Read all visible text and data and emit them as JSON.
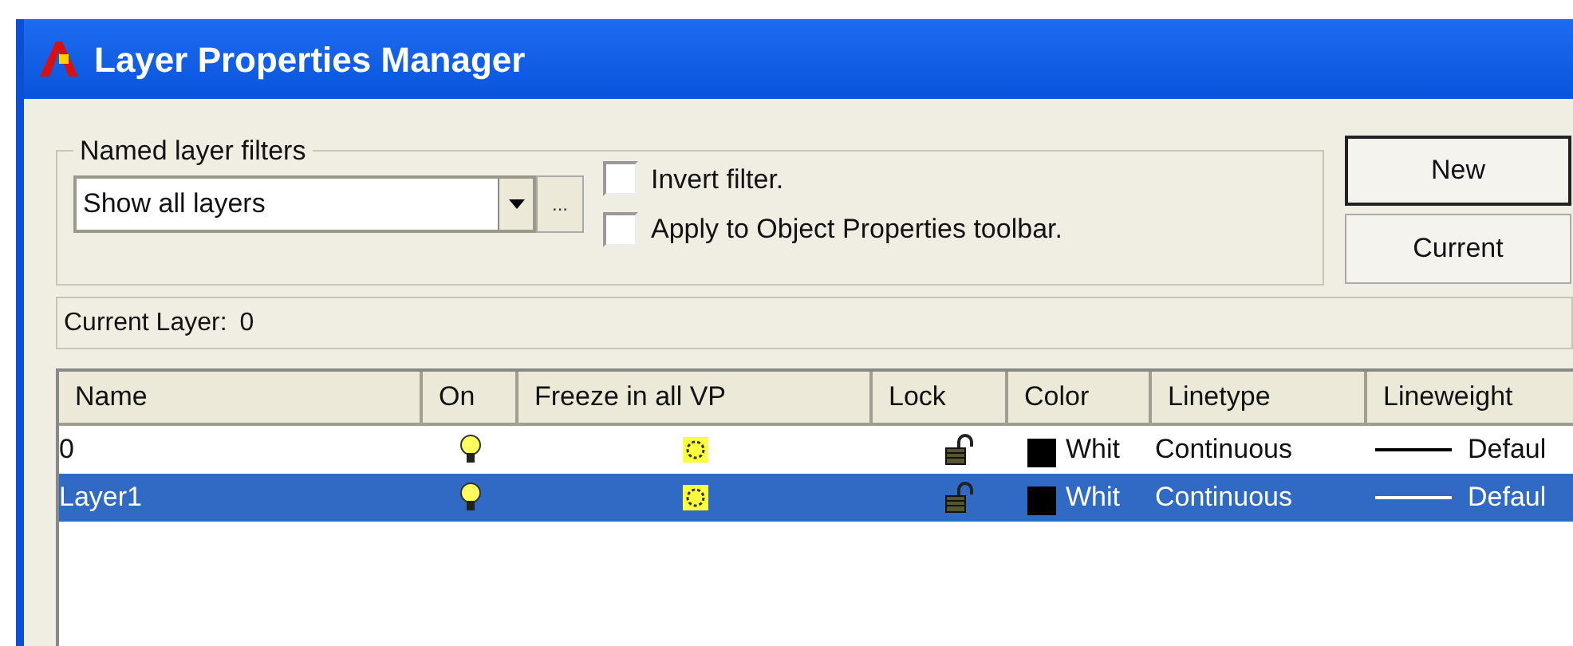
{
  "window": {
    "title": "Layer Properties Manager"
  },
  "filters": {
    "legend": "Named layer filters",
    "value": "Show all layers",
    "browse": "...",
    "checkboxes": [
      {
        "label": "Invert filter.",
        "checked": false
      },
      {
        "label": "Apply to Object Properties toolbar.",
        "checked": false
      }
    ]
  },
  "buttons": [
    "New",
    "Current"
  ],
  "current_layer": {
    "label": "Current Layer:",
    "value": "0"
  },
  "table": {
    "columns": [
      "Name",
      "On",
      "Freeze in all VP",
      "Lock",
      "Color",
      "Linetype",
      "Lineweight"
    ],
    "rows": [
      {
        "name": "0",
        "on": true,
        "frozen": false,
        "locked": false,
        "color": "#000000",
        "color_name": "Whit",
        "linetype": "Continuous",
        "lineweight": "Defaul",
        "selected": false
      },
      {
        "name": "Layer1",
        "on": true,
        "frozen": false,
        "locked": false,
        "color": "#000000",
        "color_name": "Whit",
        "linetype": "Continuous",
        "lineweight": "Defaul",
        "selected": true
      }
    ]
  }
}
